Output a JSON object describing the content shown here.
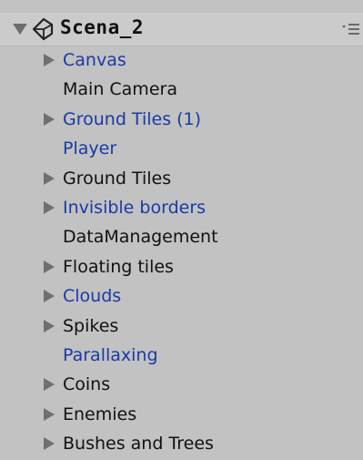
{
  "scene": {
    "title": "Scena_2",
    "icon": "unity-scene-icon",
    "menu_icon": "context-menu-icon"
  },
  "colors": {
    "background": "#c2c2c2",
    "prefab_text": "#1a3aa6",
    "normal_text": "#111111",
    "foldout_arrow": "#6f6f6f"
  },
  "hierarchy": {
    "items": [
      {
        "label": "Canvas",
        "has_children": true,
        "prefab": true
      },
      {
        "label": "Main Camera",
        "has_children": false,
        "prefab": false
      },
      {
        "label": "Ground Tiles (1)",
        "has_children": true,
        "prefab": true
      },
      {
        "label": "Player",
        "has_children": false,
        "prefab": true
      },
      {
        "label": "Ground Tiles",
        "has_children": true,
        "prefab": false
      },
      {
        "label": "Invisible borders",
        "has_children": true,
        "prefab": true
      },
      {
        "label": "DataManagement",
        "has_children": false,
        "prefab": false
      },
      {
        "label": "Floating tiles",
        "has_children": true,
        "prefab": false
      },
      {
        "label": "Clouds",
        "has_children": true,
        "prefab": true
      },
      {
        "label": "Spikes",
        "has_children": true,
        "prefab": false
      },
      {
        "label": "Parallaxing",
        "has_children": false,
        "prefab": true
      },
      {
        "label": "Coins",
        "has_children": true,
        "prefab": false
      },
      {
        "label": "Enemies",
        "has_children": true,
        "prefab": false
      },
      {
        "label": "Bushes and Trees",
        "has_children": true,
        "prefab": false
      }
    ]
  }
}
